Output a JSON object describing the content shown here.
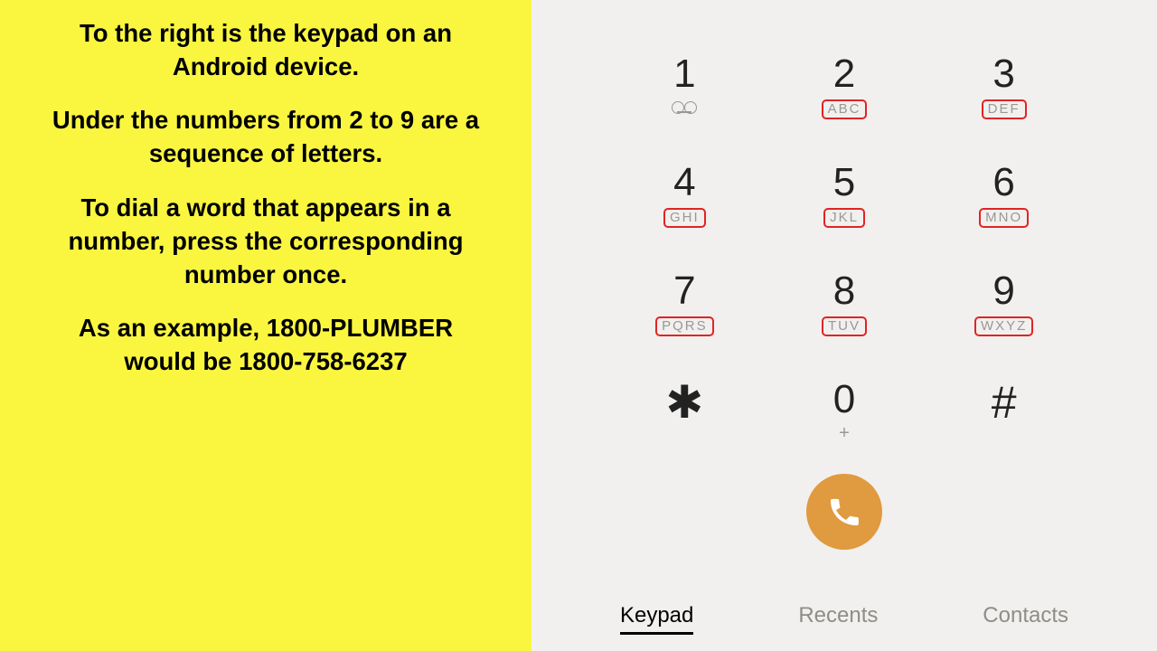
{
  "instructions": {
    "p1": "To the right is the keypad on an Android device.",
    "p2": "Under the numbers from 2 to 9 are a sequence of letters.",
    "p3": "To dial a word that appears in a number, press the corresponding number once.",
    "p4": "As an example, 1800-PLUMBER would be 1800-758-6237"
  },
  "keypad": {
    "keys": [
      {
        "digit": "1",
        "sub": "voicemail",
        "boxed": false
      },
      {
        "digit": "2",
        "sub": "ABC",
        "boxed": true
      },
      {
        "digit": "3",
        "sub": "DEF",
        "boxed": true
      },
      {
        "digit": "4",
        "sub": "GHI",
        "boxed": true
      },
      {
        "digit": "5",
        "sub": "JKL",
        "boxed": true
      },
      {
        "digit": "6",
        "sub": "MNO",
        "boxed": true
      },
      {
        "digit": "7",
        "sub": "PQRS",
        "boxed": true
      },
      {
        "digit": "8",
        "sub": "TUV",
        "boxed": true
      },
      {
        "digit": "9",
        "sub": "WXYZ",
        "boxed": true
      },
      {
        "digit": "✱",
        "sub": "",
        "symbol": true
      },
      {
        "digit": "0",
        "sub": "+",
        "plus": true
      },
      {
        "digit": "#",
        "sub": "",
        "symbol": true
      }
    ]
  },
  "tabs": {
    "keypad": "Keypad",
    "recents": "Recents",
    "contacts": "Contacts"
  }
}
